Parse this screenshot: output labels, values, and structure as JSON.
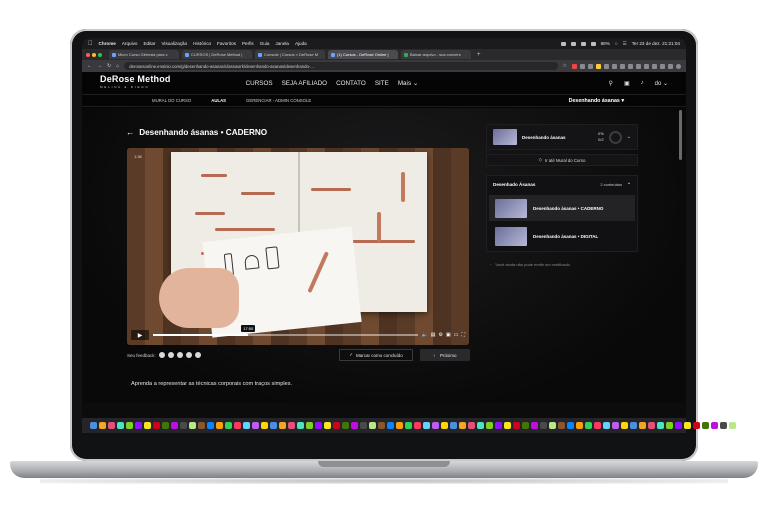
{
  "menubar": {
    "app": "Chrome",
    "items": [
      "Arquivo",
      "Editar",
      "Visualização",
      "Histórico",
      "Favoritos",
      "Perfis",
      "Guia",
      "Janela",
      "Ajuda"
    ],
    "battery": "88%",
    "datetime": "Ter 23 de dez. 21:21:04"
  },
  "browser": {
    "tabs": [
      {
        "label": "Micro Curso Gênesis para c"
      },
      {
        "label": "CURSOS | DeRose Method |"
      },
      {
        "label": "Console | Cursos > DeRose M"
      },
      {
        "label": "(1) Cursos - DeRose Online |"
      },
      {
        "label": "Baixar arquivo - sua convers"
      }
    ],
    "active_tab": 3,
    "url": "derosesonline.ensinio.com/g/desenhando-asanas/classwork/desenhando-asanas/desenhando-..."
  },
  "site": {
    "logo_main": "DeRose Method",
    "logo_sub": "MELINA & DIEGO",
    "nav": [
      "CURSOS",
      "SEJA AFILIADO",
      "CONTATO",
      "SITE",
      "Mais"
    ],
    "subnav": [
      "MURAL DO CURSO",
      "AULAS",
      "GERENCIAR - ADMIN CONSOLE"
    ],
    "active_subnav": "AULAS",
    "course_selector": "Desenhando ásanas"
  },
  "lesson": {
    "back_arrow": "←",
    "title": "Desenhando ásanas • CADERNO",
    "video": {
      "progress": 0.36,
      "time_badge": "17:50",
      "elapsed": "1:36"
    },
    "feedback_label": "Seu feedback:",
    "mark_done_label": "Marcar como concluído",
    "next_label": "Próximo",
    "description": "Aprenda a representar as técnicas corporais com traços simples."
  },
  "sidebar": {
    "course_name": "Desenhando ásanas",
    "percent": "0%",
    "fraction": "0/2",
    "mural_button": "Ir até Mural do Curso",
    "module_name": "Desenhado Ásanas",
    "module_count": "2 conteúdos",
    "lessons": [
      {
        "title": "Desenhando ásanas • CADERNO"
      },
      {
        "title": "Desenhando ásanas • DIGITAL"
      }
    ],
    "certificate_note": "Você ainda não pode emitir um certificado"
  }
}
